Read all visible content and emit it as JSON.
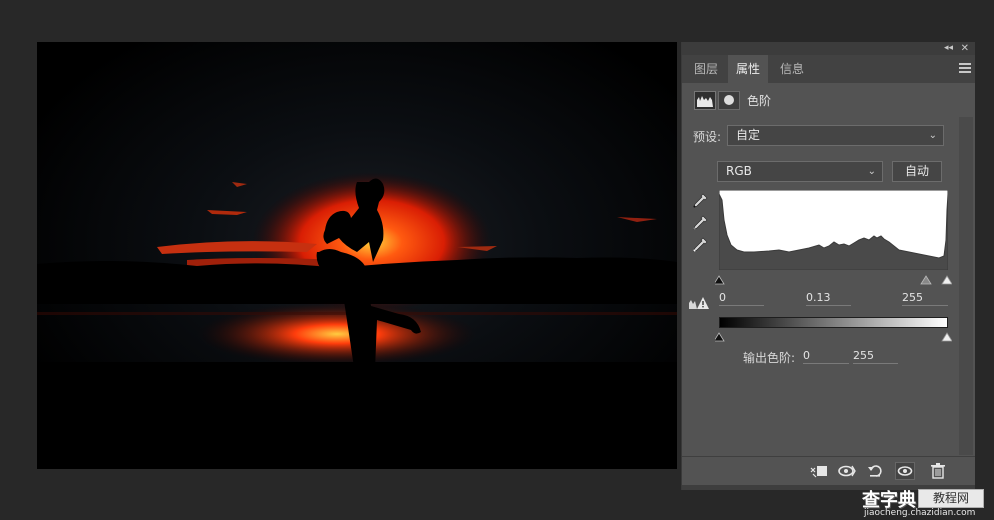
{
  "panel": {
    "collapse_glyph": "◂◂",
    "close_glyph": "✕",
    "tabs": [
      {
        "label": "图层",
        "active": false
      },
      {
        "label": "属性",
        "active": true
      },
      {
        "label": "信息",
        "active": false
      }
    ],
    "adjustment_title": "色阶",
    "preset_label": "预设:",
    "preset_value": "自定",
    "channel_value": "RGB",
    "auto_label": "自动",
    "input_levels": {
      "black": "0",
      "gamma": "0.13",
      "white": "255"
    },
    "output_label": "输出色阶:",
    "output_levels": {
      "black": "0",
      "white": "255"
    },
    "dropdown_chevron": "⌄"
  },
  "canvas": {
    "description_colors": {
      "sun": "#ff3a10",
      "sky": "#050608",
      "glow": "#c81e06"
    }
  },
  "watermark": {
    "logo_main": "查字典",
    "logo_box": "教程网",
    "url": "jiaocheng.chazidian.com"
  },
  "icons": {
    "levels": "levels-histogram-icon",
    "mask": "layer-mask-icon",
    "clip_warning": "clipping-warning-icon",
    "clip_to_layer": "clip-to-layer-icon",
    "view_previous": "view-previous-state-icon",
    "reset": "reset-icon",
    "visibility": "eye-icon",
    "delete": "trash-icon"
  }
}
